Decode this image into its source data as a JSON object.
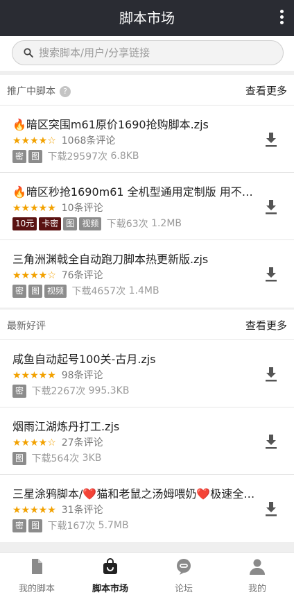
{
  "header": {
    "title": "脚本市场",
    "more_icon": "more-vertical-icon"
  },
  "search": {
    "placeholder": "搜索脚本/用户/分享链接"
  },
  "promoted": {
    "title": "推广中脚本",
    "more_label": "查看更多",
    "items": [
      {
        "name": "🔥暗区突围m61原价1690抢购脚本.zjs",
        "stars": "★★★★☆",
        "rating": 4.5,
        "reviews": "1068条评论",
        "tags": [
          "密",
          "图"
        ],
        "downloads": "下载29597次",
        "size": "6.8KB"
      },
      {
        "name": "🔥暗区秒抢1690m61 全机型通用定制版 用不了…",
        "stars": "★★★★★",
        "rating": 5,
        "reviews": "10条评论",
        "price": "10元",
        "tags": [
          "卡密",
          "图",
          "视频"
        ],
        "downloads": "下载63次",
        "size": "1.2MB"
      },
      {
        "name": "三角洲渊戟全自动跑刀脚本热更新版.zjs",
        "stars": "★★★★☆",
        "rating": 4.5,
        "reviews": "76条评论",
        "tags": [
          "密",
          "图",
          "视频"
        ],
        "downloads": "下载4657次",
        "size": "1.4MB"
      }
    ]
  },
  "latest": {
    "title": "最新好评",
    "more_label": "查看更多",
    "items": [
      {
        "name": "咸鱼自动起号100关-古月.zjs",
        "stars": "★★★★★",
        "rating": 5,
        "reviews": "98条评论",
        "tags": [
          "密"
        ],
        "downloads": "下载2267次",
        "size": "995.3KB"
      },
      {
        "name": "烟雨江湖炼丹打工.zjs",
        "stars": "★★★★☆",
        "rating": 4,
        "reviews": "27条评论",
        "tags": [
          "图"
        ],
        "downloads": "下载564次",
        "size": "3KB"
      },
      {
        "name": "三星涂鸦脚本/❤️猫和老鼠之汤姆喂奶❤️极速全…",
        "stars": "★★★★★",
        "rating": 5,
        "reviews": "31条评论",
        "tags": [
          "密",
          "图"
        ],
        "downloads": "下载167次",
        "size": "5.7MB"
      }
    ]
  },
  "bottom_nav": [
    {
      "label": "我的脚本",
      "icon": "document-icon",
      "active": false
    },
    {
      "label": "脚本市场",
      "icon": "shopping-bag-icon",
      "active": true
    },
    {
      "label": "论坛",
      "icon": "chat-bubble-icon",
      "active": false
    },
    {
      "label": "我的",
      "icon": "person-icon",
      "active": false
    }
  ],
  "colors": {
    "header_bg": "#2a2c33",
    "star": "#f2a100",
    "tag_gray": "#8c8c8c",
    "tag_dark_red": "#5a1212"
  }
}
